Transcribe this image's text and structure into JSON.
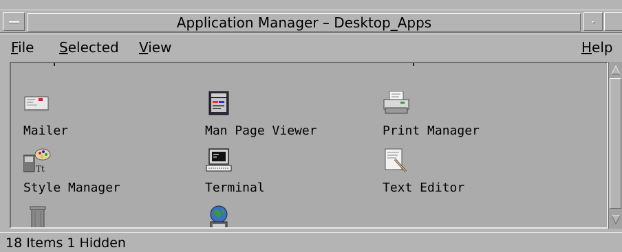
{
  "window": {
    "title": "Application Manager – Desktop_Apps"
  },
  "menubar": {
    "file": {
      "mnemonic": "F",
      "rest": "ile"
    },
    "selected": {
      "mnemonic": "S",
      "rest": "elected"
    },
    "view": {
      "mnemonic": "V",
      "rest": "iew"
    },
    "help": {
      "mnemonic": "H",
      "rest": "elp"
    }
  },
  "icons": [
    {
      "label": "Mailer",
      "icon": "mailer-icon"
    },
    {
      "label": "Man Page Viewer",
      "icon": "man-page-viewer-icon"
    },
    {
      "label": "Print Manager",
      "icon": "printer-icon"
    },
    {
      "label": "Style Manager",
      "icon": "style-manager-icon"
    },
    {
      "label": "Terminal",
      "icon": "terminal-icon"
    },
    {
      "label": "Text Editor",
      "icon": "text-editor-icon"
    },
    {
      "label": "",
      "icon": "trash-can-icon"
    },
    {
      "label": "",
      "icon": "web-browser-icon"
    }
  ],
  "status": {
    "text": "18 Items 1 Hidden"
  }
}
